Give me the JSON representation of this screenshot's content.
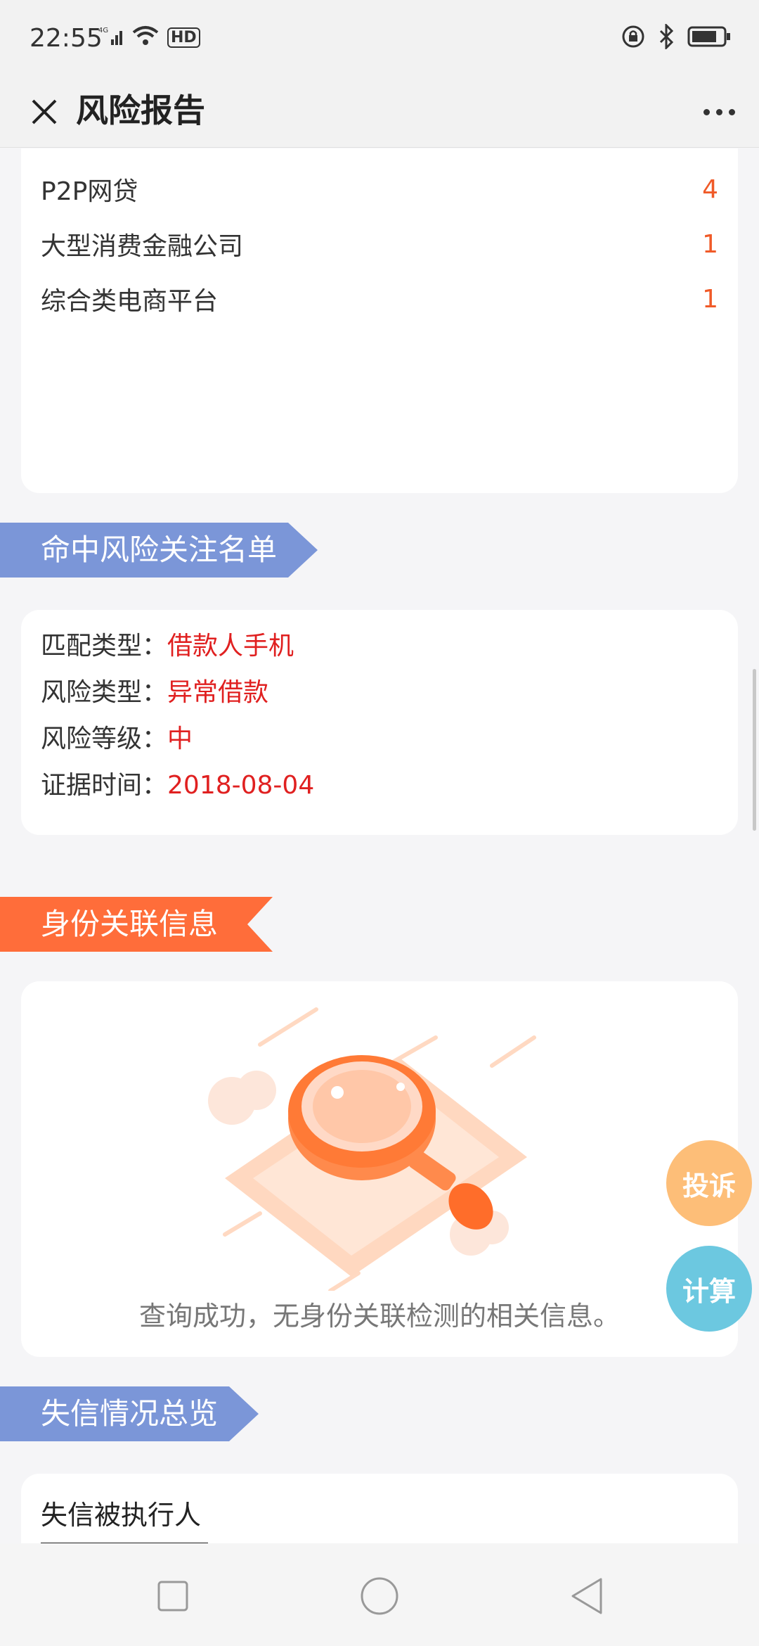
{
  "status_bar": {
    "time": "22:55",
    "network": "4G",
    "hd": "HD"
  },
  "app_bar": {
    "title": "风险报告"
  },
  "institution_types": [
    {
      "label": "P2P网贷",
      "count": "4"
    },
    {
      "label": "大型消费金融公司",
      "count": "1"
    },
    {
      "label": "综合类电商平台",
      "count": "1"
    }
  ],
  "watchlist_section": {
    "title": "命中风险关注名单",
    "rows": [
      {
        "key": "匹配类型：",
        "value": "借款人手机"
      },
      {
        "key": "风险类型：",
        "value": "异常借款"
      },
      {
        "key": "风险等级：",
        "value": "中"
      },
      {
        "key": "证据时间：",
        "value": "2018-08-04"
      }
    ]
  },
  "identity_section": {
    "title": "身份关联信息",
    "empty_message": "查询成功，无身份关联检测的相关信息。"
  },
  "dishonest_section": {
    "title": "失信情况总览",
    "active_tab": "失信被执行人"
  },
  "floating_buttons": {
    "complain": "投诉",
    "calculate": "计算"
  },
  "colors": {
    "accent_orange": "#ff6d3a",
    "accent_blue": "#7b96d8",
    "count_color": "#f05a28",
    "value_red": "#e02020"
  }
}
